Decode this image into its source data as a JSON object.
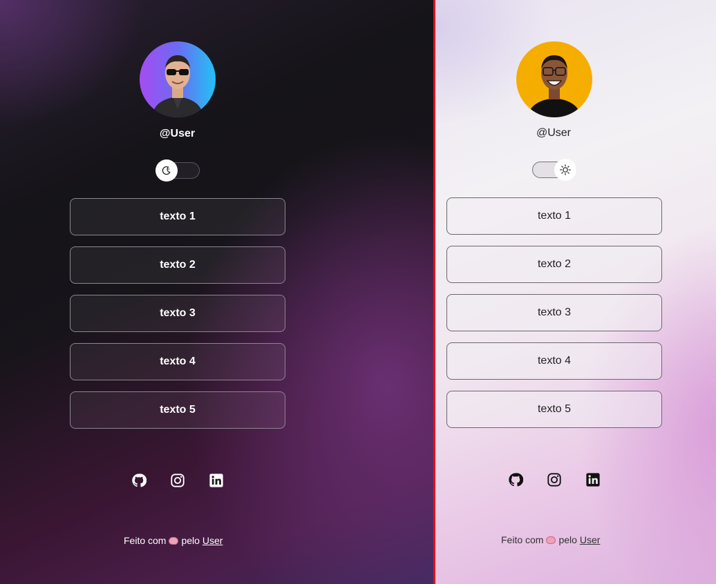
{
  "dark_panel": {
    "username": "@User",
    "theme_icon": "moon-icon",
    "links": [
      "texto 1",
      "texto 2",
      "texto 3",
      "texto 4",
      "texto 5"
    ],
    "socials": [
      "github-icon",
      "instagram-icon",
      "linkedin-icon"
    ],
    "footer": {
      "prefix": "Feito com",
      "emoji": "brain-icon",
      "middle": "pelo",
      "author": "User"
    }
  },
  "light_panel": {
    "username": "@User",
    "theme_icon": "sun-icon",
    "links": [
      "texto 1",
      "texto 2",
      "texto 3",
      "texto 4",
      "texto 5"
    ],
    "socials": [
      "github-icon",
      "instagram-icon",
      "linkedin-icon"
    ],
    "footer": {
      "prefix": "Feito com",
      "emoji": "brain-icon",
      "middle": "pelo",
      "author": "User"
    }
  },
  "colors": {
    "divider": "#e0141c",
    "dark_avatar_gradient_start": "#a64cf2",
    "dark_avatar_gradient_end": "#22c2f5",
    "light_avatar_bg": "#f5ad00"
  }
}
